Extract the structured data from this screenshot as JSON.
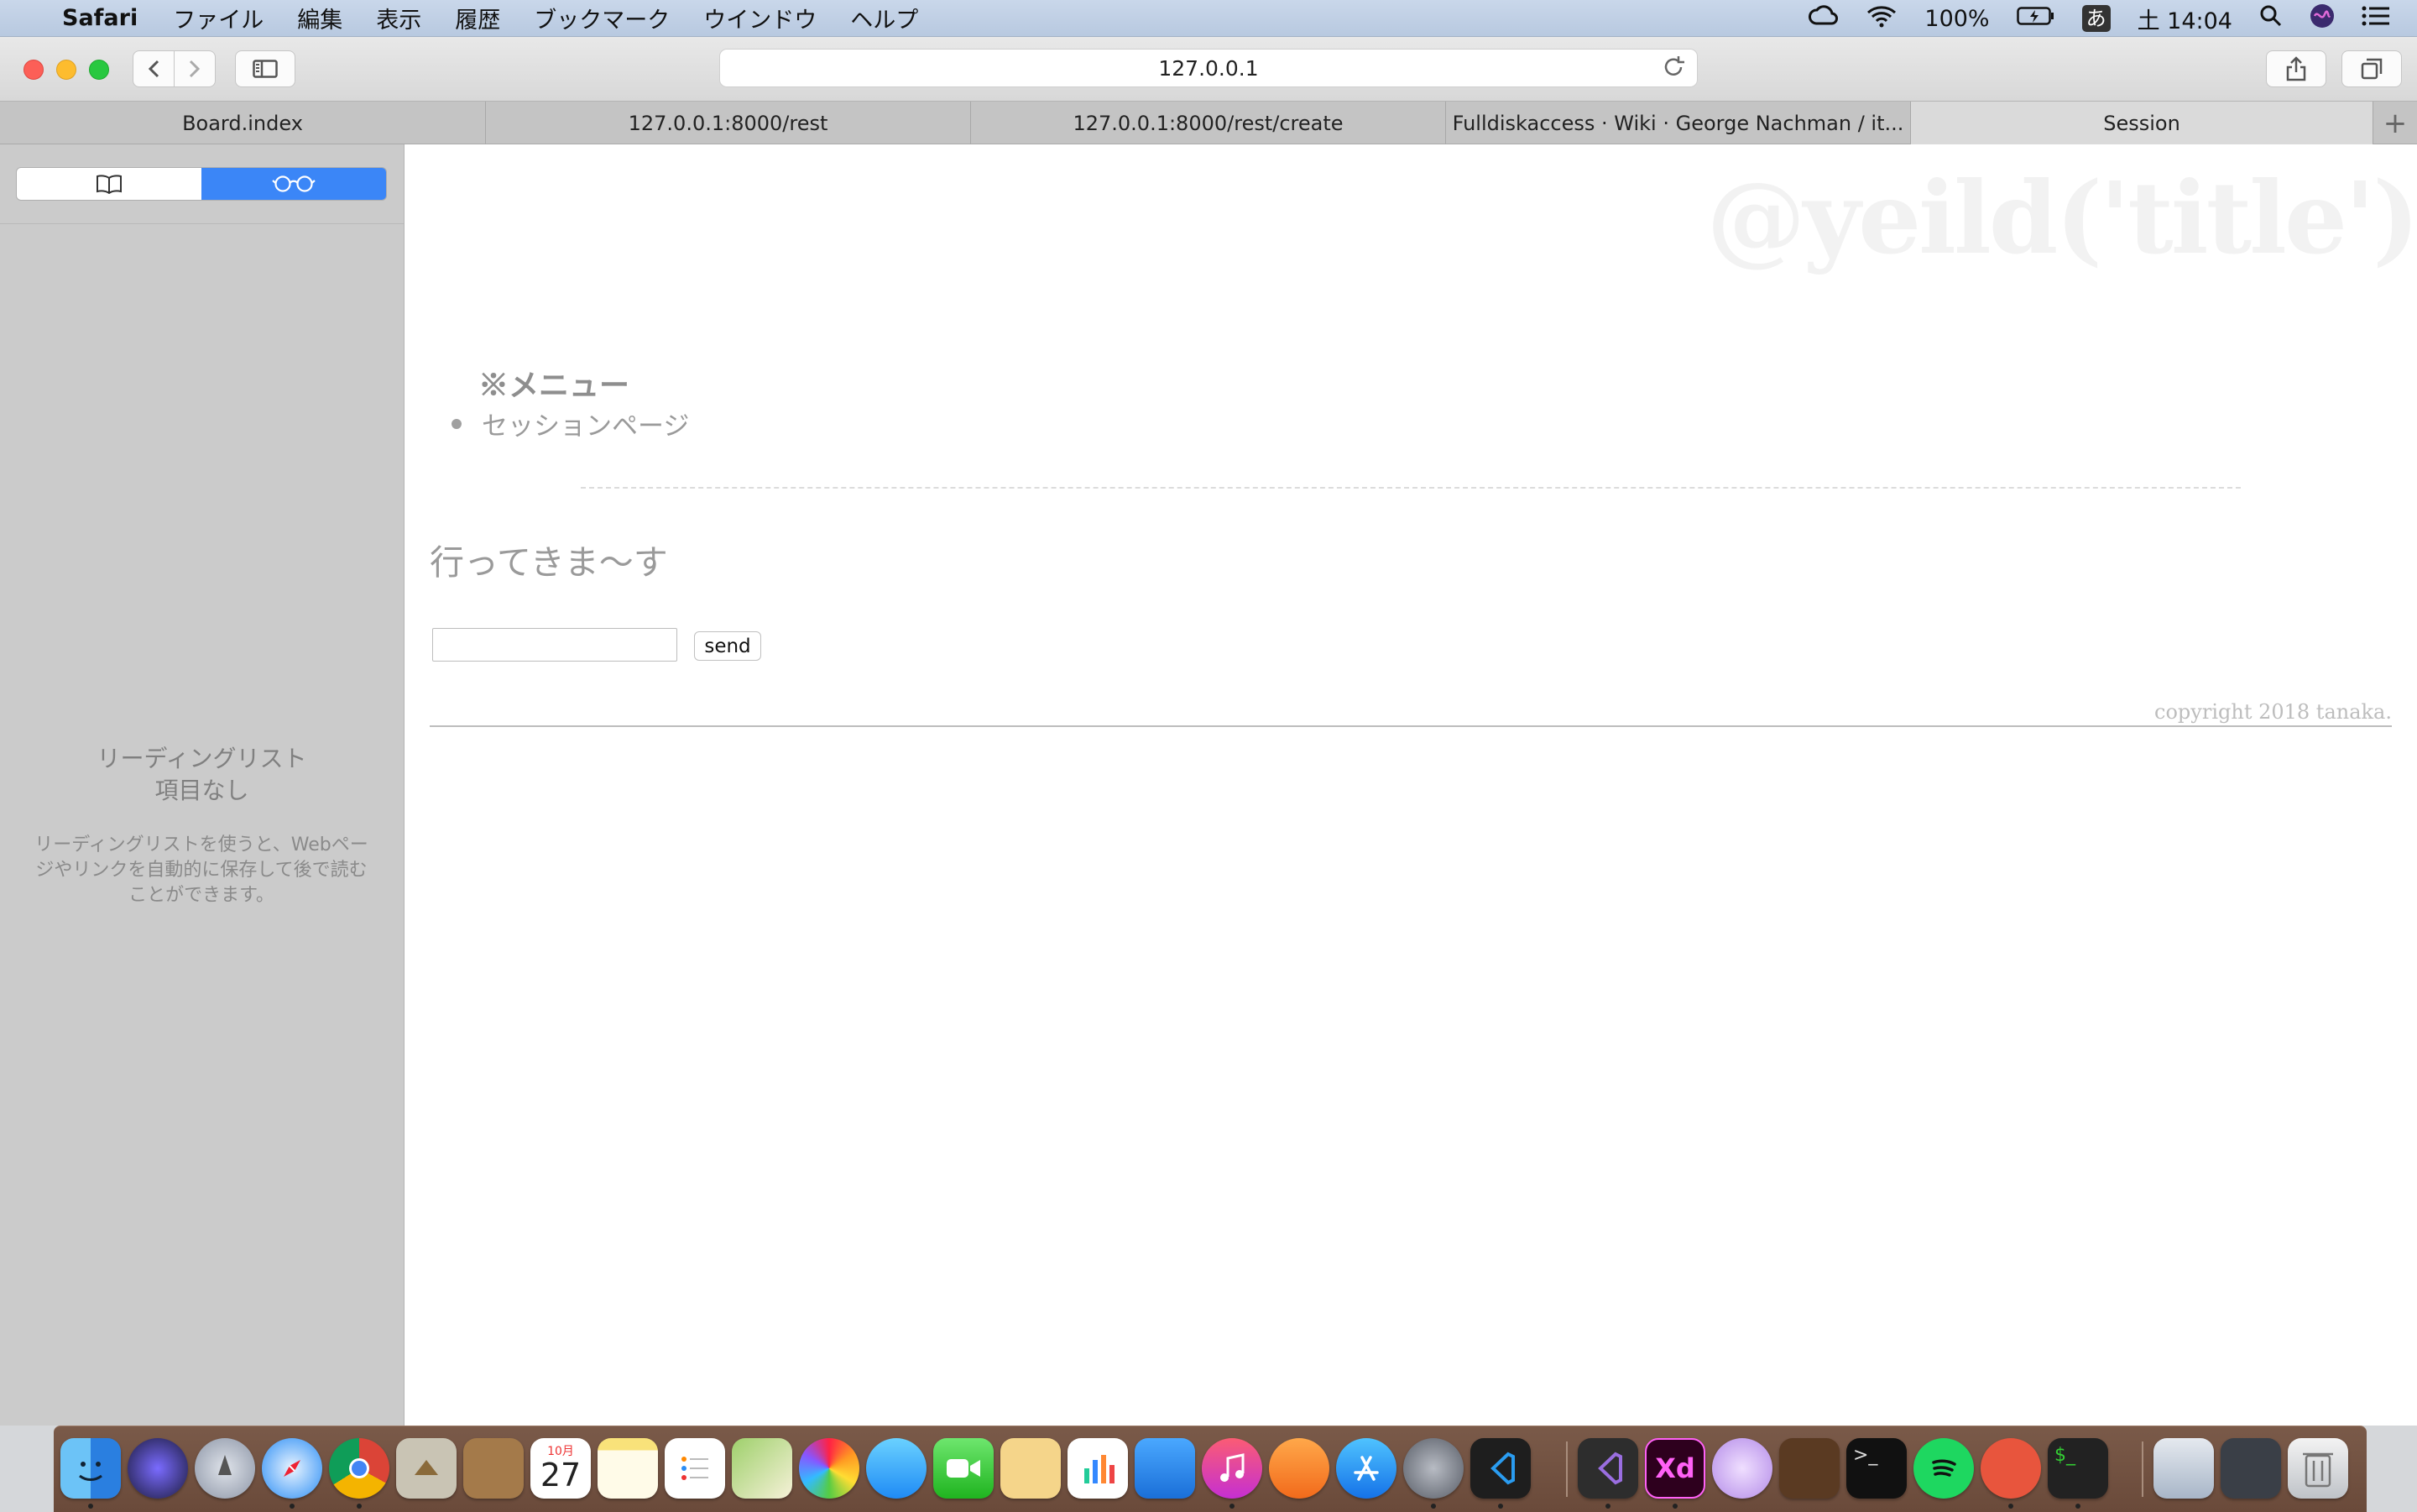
{
  "menubar": {
    "app_name": "Safari",
    "items": [
      "ファイル",
      "編集",
      "表示",
      "履歴",
      "ブックマーク",
      "ウインドウ",
      "ヘルプ"
    ],
    "battery": "100%",
    "ime": "あ",
    "clock": "土 14:04"
  },
  "toolbar": {
    "url": "127.0.0.1"
  },
  "tabs": [
    {
      "label": "Board.index",
      "active": false
    },
    {
      "label": "127.0.0.1:8000/rest",
      "active": false
    },
    {
      "label": "127.0.0.1:8000/rest/create",
      "active": false
    },
    {
      "label": "Fulldiskaccess · Wiki · George Nachman / it...",
      "active": false
    },
    {
      "label": "Session",
      "active": true
    }
  ],
  "sidebar": {
    "reading_list_title_1": "リーディングリスト",
    "reading_list_title_2": "項目なし",
    "reading_list_desc": "リーディングリストを使うと、Webページやリンクを自動的に保存して後で読むことができます。"
  },
  "page": {
    "ghost_title": "@yeild('title')",
    "menu_heading": "※メニュー",
    "menu_items": [
      "セッションページ"
    ],
    "message": "行ってきま〜す",
    "input_value": "",
    "send_label": "send",
    "copyright": "copyright 2018 tanaka."
  },
  "dock": {
    "calendar_month": "10月",
    "calendar_day": "27",
    "xd_label": "Xd"
  },
  "colors": {
    "accent_blue": "#3b86f7",
    "sidebar_bg": "#cbcbcb",
    "dock_bg": "#6f4f3f"
  }
}
